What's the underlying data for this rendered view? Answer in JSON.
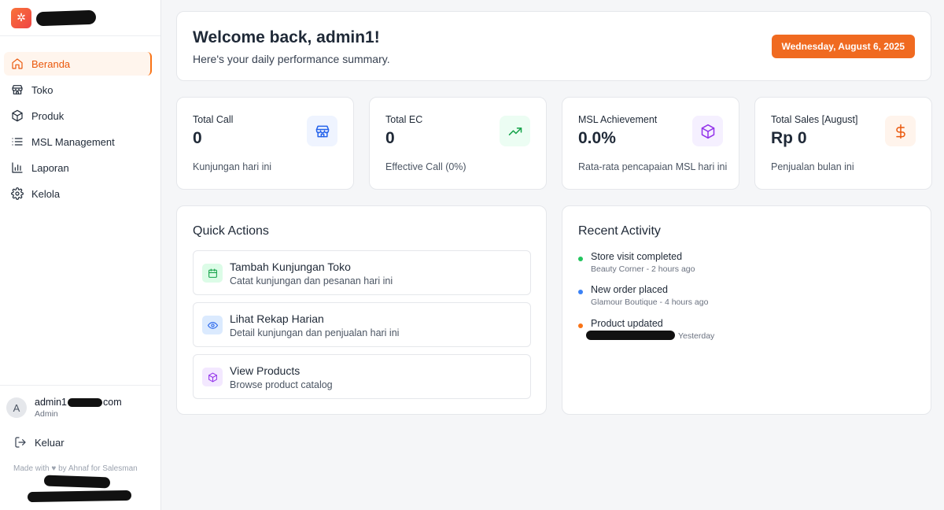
{
  "brand": {
    "logo_icon": "sparkle-icon"
  },
  "sidebar": {
    "items": [
      {
        "label": "Beranda",
        "icon": "home-icon",
        "active": true
      },
      {
        "label": "Toko",
        "icon": "store-icon"
      },
      {
        "label": "Produk",
        "icon": "box-icon"
      },
      {
        "label": "MSL Management",
        "icon": "list-icon"
      },
      {
        "label": "Laporan",
        "icon": "bar-chart-icon"
      },
      {
        "label": "Kelola",
        "icon": "gear-icon"
      }
    ],
    "user": {
      "avatar_letter": "A",
      "email_prefix": "admin1",
      "email_suffix": "com",
      "role": "Admin"
    },
    "logout_label": "Keluar",
    "footer": "Made with ♥ by Ahnaf for Salesman"
  },
  "welcome": {
    "title": "Welcome back, admin1!",
    "subtitle": "Here's your daily performance summary.",
    "date": "Wednesday, August 6, 2025"
  },
  "stats": [
    {
      "label": "Total Call",
      "value": "0",
      "sub": "Kunjungan hari ini",
      "icon": "store-icon",
      "color": "#2563eb",
      "bg": "#eff4ff"
    },
    {
      "label": "Total EC",
      "value": "0",
      "sub": "Effective Call (0%)",
      "icon": "trending-up-icon",
      "color": "#16a34a",
      "bg": "#ecfdf3"
    },
    {
      "label": "MSL Achievement",
      "value": "0.0%",
      "sub": "Rata-rata pencapaian MSL hari ini",
      "icon": "box-icon",
      "color": "#9333ea",
      "bg": "#f5f0ff"
    },
    {
      "label": "Total Sales [August]",
      "value": "Rp 0",
      "sub": "Penjualan bulan ini",
      "icon": "dollar-icon",
      "color": "#ea580c",
      "bg": "#fff4ec"
    }
  ],
  "quick_actions": {
    "title": "Quick Actions",
    "items": [
      {
        "title": "Tambah Kunjungan Toko",
        "subtitle": "Catat kunjungan dan pesanan hari ini",
        "icon": "calendar-icon",
        "color": "#16a34a",
        "bg": "#dcfce7"
      },
      {
        "title": "Lihat Rekap Harian",
        "subtitle": "Detail kunjungan dan penjualan hari ini",
        "icon": "eye-icon",
        "color": "#2563eb",
        "bg": "#dbeafe"
      },
      {
        "title": "View Products",
        "subtitle": "Browse product catalog",
        "icon": "box-icon",
        "color": "#9333ea",
        "bg": "#f3e8ff"
      }
    ]
  },
  "recent_activity": {
    "title": "Recent Activity",
    "items": [
      {
        "title": "Store visit completed",
        "subtitle": "Beauty Corner - 2 hours ago",
        "color": "#22c55e"
      },
      {
        "title": "New order placed",
        "subtitle": "Glamour Boutique - 4 hours ago",
        "color": "#3b82f6"
      },
      {
        "title": "Product updated",
        "subtitle": "Yesterday",
        "color": "#f97316"
      }
    ]
  }
}
